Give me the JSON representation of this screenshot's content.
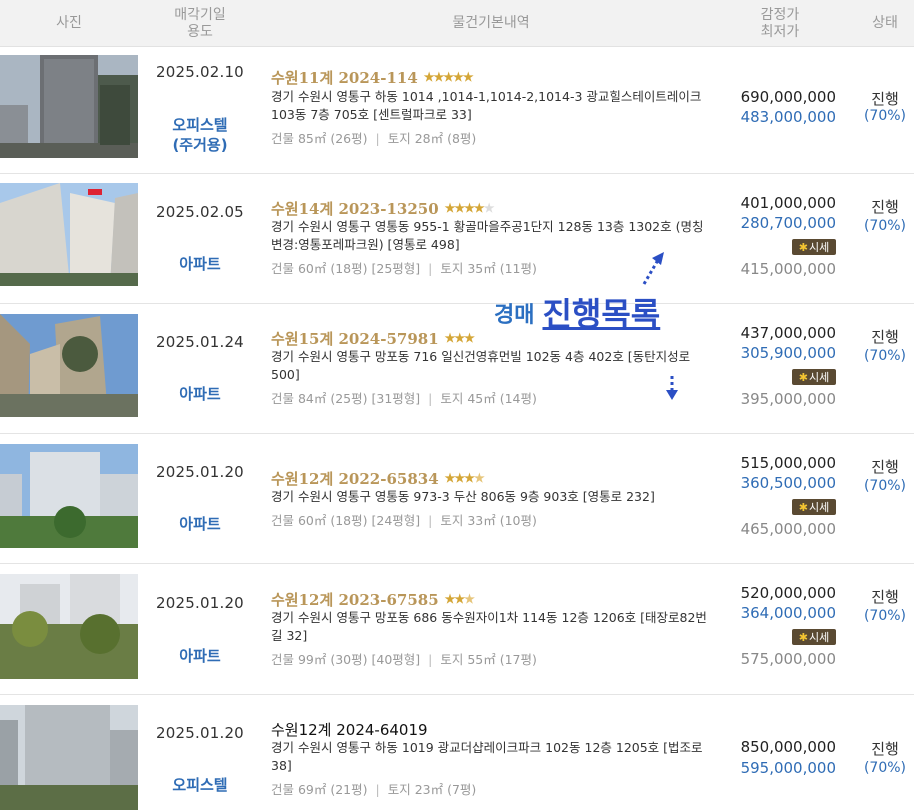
{
  "header": {
    "photo": "사진",
    "sale_date_usage": "매각기일\n용도",
    "details": "물건기본내역",
    "appraisal_min": "감정가\n최저가",
    "status": "상태"
  },
  "rows": [
    {
      "date": "2025.02.10",
      "usage": "오피스텔\n(주거용)",
      "case": "수원11계 2024-114",
      "stars": 5,
      "address": "경기 수원시 영통구 하동 1014 ,1014-1,1014-2,1014-3 광교힐스테이트레이크 103동 7층 705호 [센트럴파크로 33]",
      "building": "건물 85㎡ (26평)",
      "land": "토지 28㎡ (8평)",
      "appraisal": "690,000,000",
      "minimum": "483,000,000",
      "status": "진행",
      "rate": "(70%)"
    },
    {
      "date": "2025.02.05",
      "usage": "아파트",
      "case": "수원14계 2023-13250",
      "stars": 4,
      "address": "경기 수원시 영통구 영통동 955-1 황골마을주공1단지 128동 13층 1302호 (명칭변경:영통포레파크원) [영통로 498]",
      "building": "건물 60㎡ (18평) [25평형]",
      "land": "토지 35㎡ (11평)",
      "appraisal": "401,000,000",
      "minimum": "280,700,000",
      "market_label": "시세",
      "market_price": "415,000,000",
      "status": "진행",
      "rate": "(70%)"
    },
    {
      "date": "2025.01.24",
      "usage": "아파트",
      "case": "수원15계 2024-57981",
      "stars": 3,
      "address": "경기 수원시 영통구 망포동 716 일신건영휴먼빌 102동 4층 402호 [동탄지성로 500]",
      "building": "건물 84㎡ (25평) [31평형]",
      "land": "토지 45㎡ (14평)",
      "appraisal": "437,000,000",
      "minimum": "305,900,000",
      "market_label": "시세",
      "market_price": "395,000,000",
      "status": "진행",
      "rate": "(70%)"
    },
    {
      "date": "2025.01.20",
      "usage": "아파트",
      "case": "수원12계 2022-65834",
      "stars": 3.5,
      "address": "경기 수원시 영통구 영통동 973-3 두산 806동 9층 903호 [영통로 232]",
      "building": "건물 60㎡ (18평) [24평형]",
      "land": "토지 33㎡ (10평)",
      "appraisal": "515,000,000",
      "minimum": "360,500,000",
      "market_label": "시세",
      "market_price": "465,000,000",
      "status": "진행",
      "rate": "(70%)"
    },
    {
      "date": "2025.01.20",
      "usage": "아파트",
      "case": "수원12계 2023-67585",
      "stars": 2.5,
      "address": "경기 수원시 영통구 망포동 686 동수원자이1차 114동 12층 1206호 [태장로82번길 32]",
      "building": "건물 99㎡ (30평) [40평형]",
      "land": "토지 55㎡ (17평)",
      "appraisal": "520,000,000",
      "minimum": "364,000,000",
      "market_label": "시세",
      "market_price": "575,000,000",
      "status": "진행",
      "rate": "(70%)"
    },
    {
      "date": "2025.01.20",
      "usage": "오피스텔",
      "case": "수원12계 2024-64019",
      "stars": 0,
      "address": "경기 수원시 영통구 하동 1019 광교더샵레이크파크 102동 12층 1205호 [법조로 38]",
      "building": "건물 69㎡ (21평)",
      "land": "토지 23㎡ (7평)",
      "appraisal": "850,000,000",
      "minimum": "595,000,000",
      "status": "진행",
      "rate": "(70%)"
    }
  ],
  "overlay": {
    "small": "경매",
    "large": "진행목록"
  },
  "colors": {
    "case_gold": "#b99659",
    "link_blue": "#2f6cb5",
    "star": "#d4a637",
    "market_badge": "#5a4a32"
  }
}
